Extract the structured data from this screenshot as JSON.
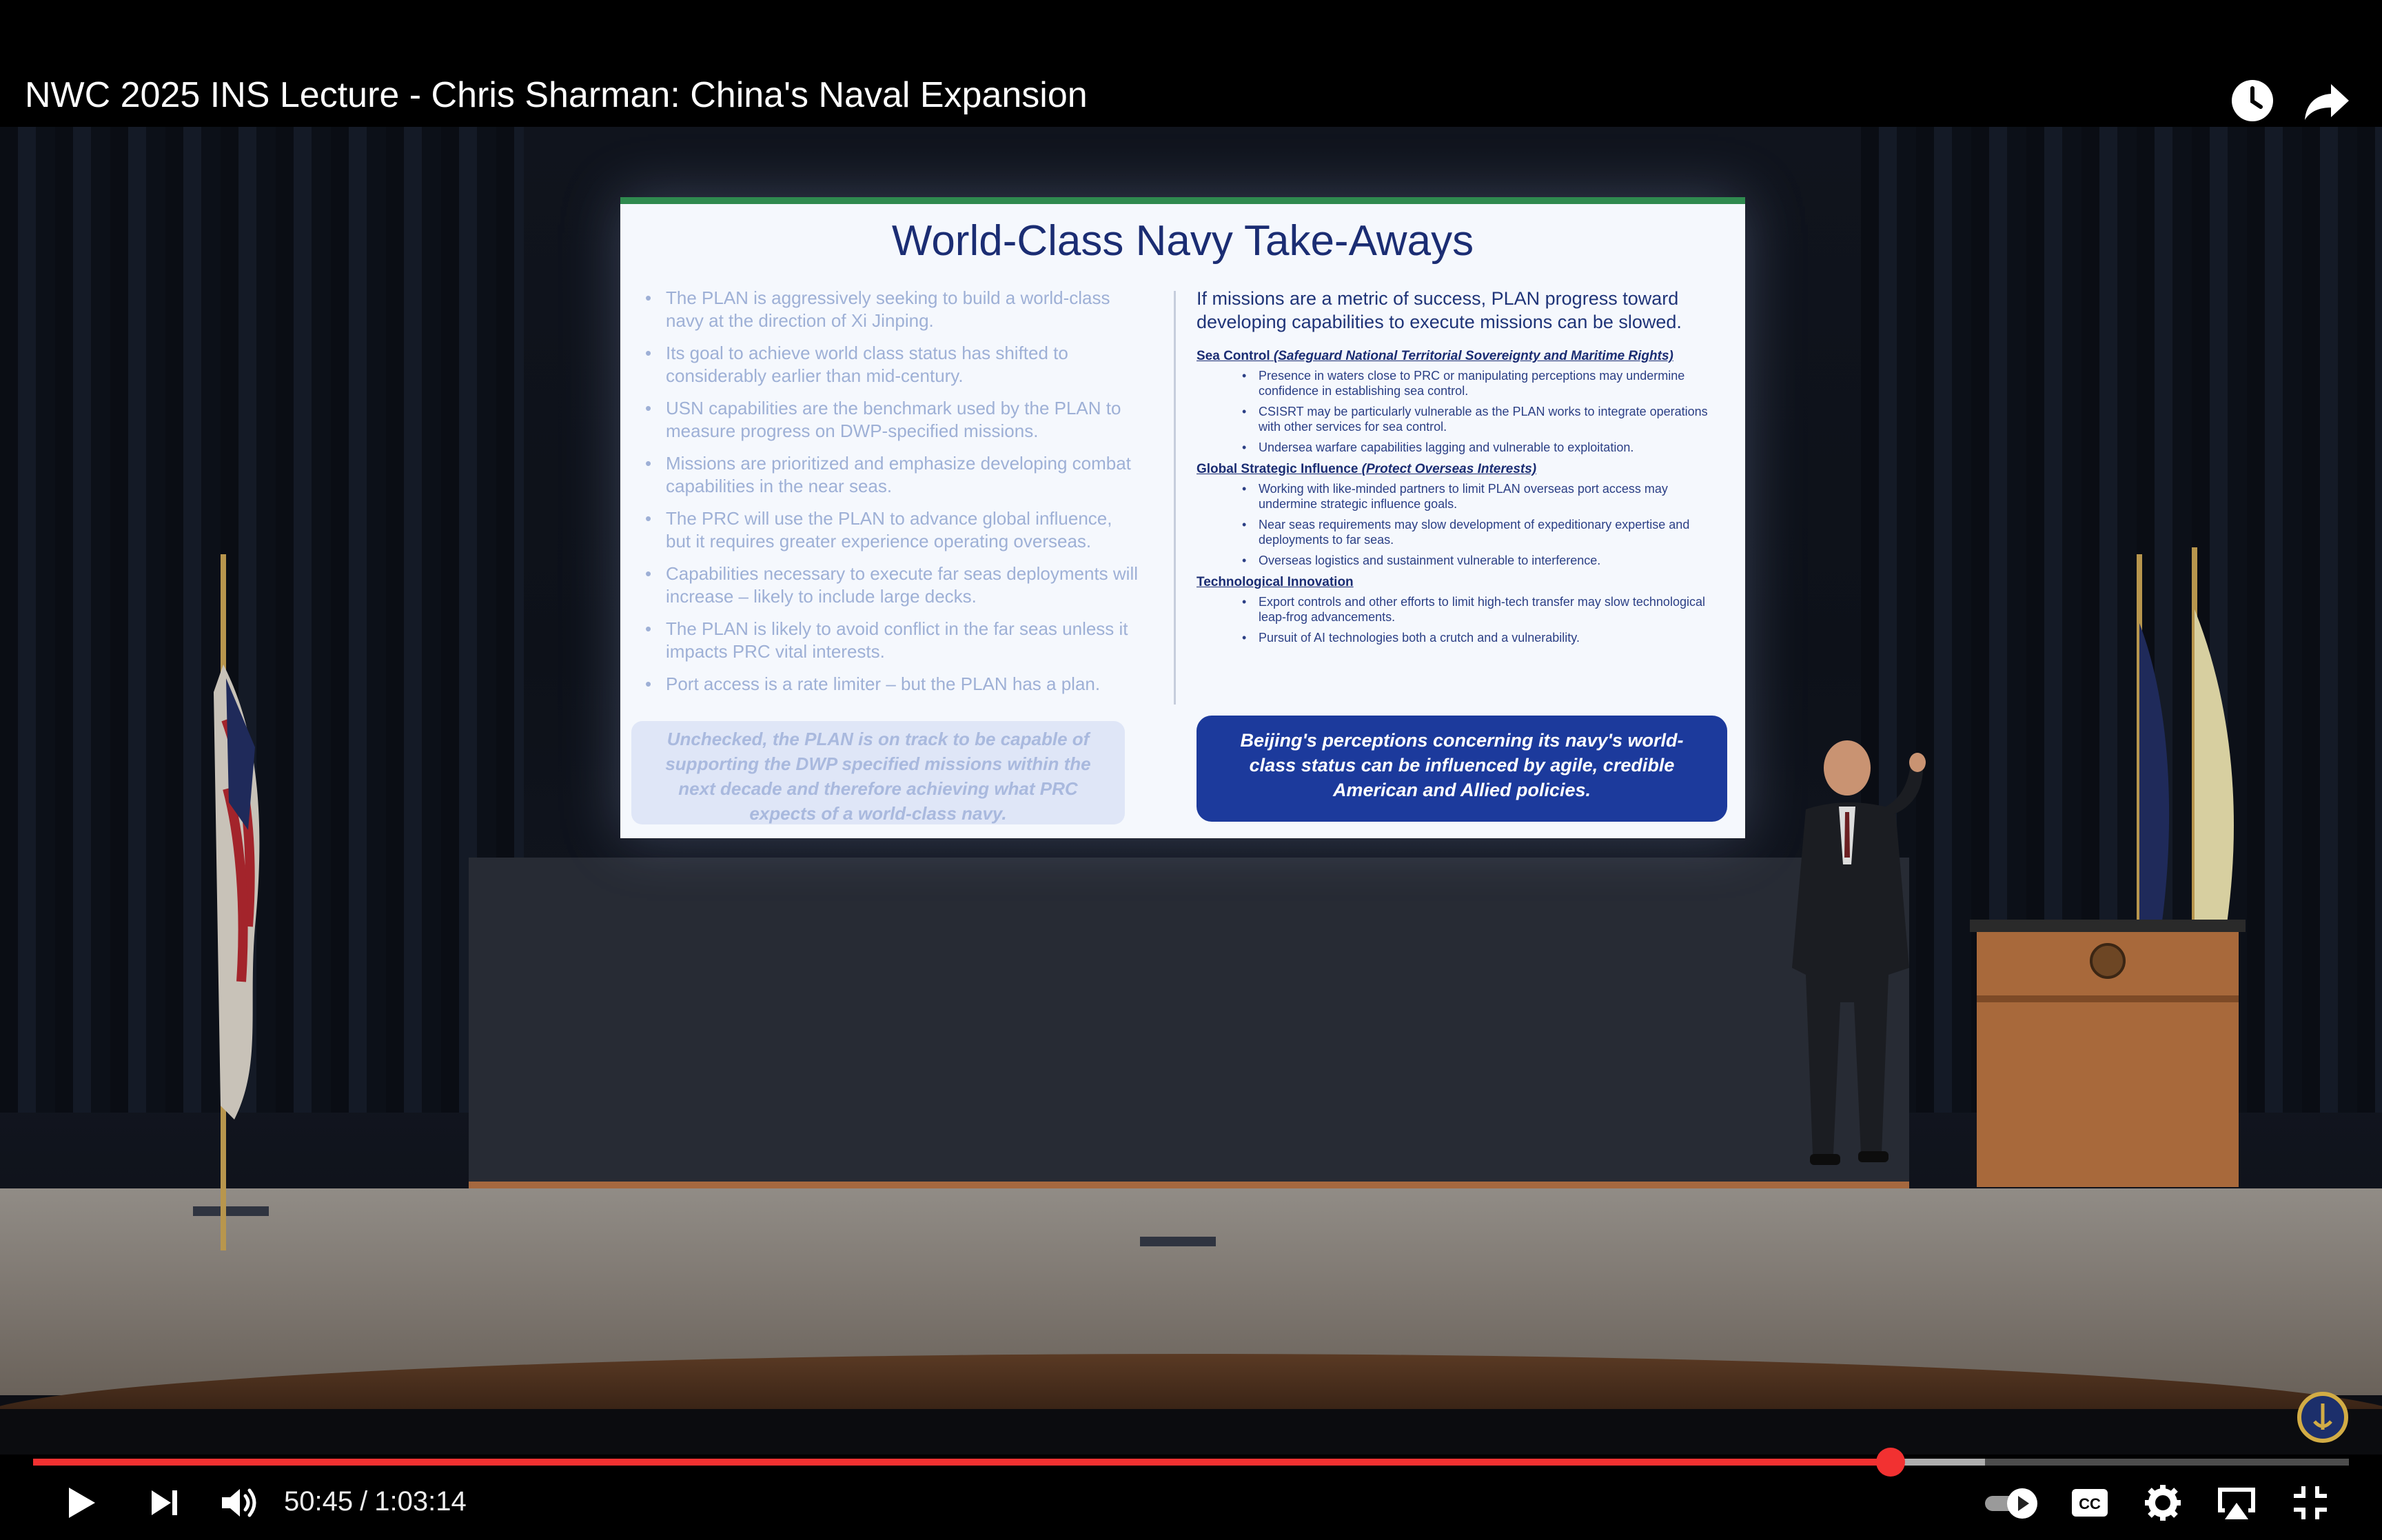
{
  "video": {
    "title": "NWC 2025 INS Lecture - Chris Sharman: China's Naval Expansion"
  },
  "player": {
    "current_time": "50:45",
    "time_separator": "/",
    "duration": "1:03:14",
    "progress_fraction": 0.802,
    "buffered_fraction": 0.843,
    "accent_color": "#f23131",
    "icons": {
      "watch_later": "clock-icon",
      "share": "share-arrow-icon",
      "play": "play-icon",
      "next": "skip-next-icon",
      "volume": "volume-icon",
      "autoplay": "autoplay-toggle-icon",
      "captions": "closed-captions-icon",
      "settings": "gear-icon",
      "airplay": "airplay-icon",
      "fullscreen": "exit-fullscreen-icon"
    }
  },
  "slide": {
    "title": "World-Class Navy Take-Aways",
    "left_bullets": [
      "The PLAN is aggressively seeking to build a world-class navy at the direction of Xi Jinping.",
      "Its goal to achieve world class status has shifted to considerably earlier than mid-century.",
      "USN capabilities are the benchmark used by the PLAN to measure progress on DWP-specified missions.",
      "Missions are prioritized and emphasize developing combat capabilities in the near seas.",
      "The PRC will use the PLAN to advance global influence, but it requires greater experience operating overseas.",
      "Capabilities necessary to execute far seas deployments will increase – likely to include large decks.",
      "The PLAN is likely to avoid conflict in the far seas unless it impacts PRC vital interests.",
      "Port access is a rate limiter – but the PLAN has a plan."
    ],
    "left_callout": "Unchecked, the PLAN is on track to be capable of supporting the DWP specified missions within the next decade and therefore achieving what PRC expects of a world-class navy.",
    "right_intro": "If missions are a metric of success, PLAN progress toward developing capabilities to execute missions can be slowed.",
    "sections": [
      {
        "heading": "Sea Control",
        "heading_italic": "(Safeguard National Territorial Sovereignty and Maritime Rights)",
        "bullets": [
          "Presence in waters close to PRC or manipulating perceptions may undermine confidence in establishing sea control.",
          "CSISRT may be particularly vulnerable as the PLAN works to integrate operations with other services for sea control.",
          "Undersea warfare capabilities lagging and vulnerable to exploitation."
        ]
      },
      {
        "heading": "Global Strategic Influence",
        "heading_italic": "(Protect Overseas Interests)",
        "bullets": [
          "Working with like-minded partners to limit PLAN overseas port access may undermine strategic influence goals.",
          "Near seas requirements may slow development of expeditionary expertise and deployments to far seas.",
          "Overseas logistics and sustainment vulnerable to interference."
        ]
      },
      {
        "heading": "Technological Innovation",
        "heading_italic": "",
        "bullets": [
          "Export controls and other efforts to limit high-tech transfer may slow technological leap-frog advancements.",
          "Pursuit of AI technologies both a crutch and a vulnerability."
        ]
      }
    ],
    "right_callout": "Beijing's perceptions concerning its navy's world-class status can be influenced by agile, credible American and Allied policies."
  }
}
